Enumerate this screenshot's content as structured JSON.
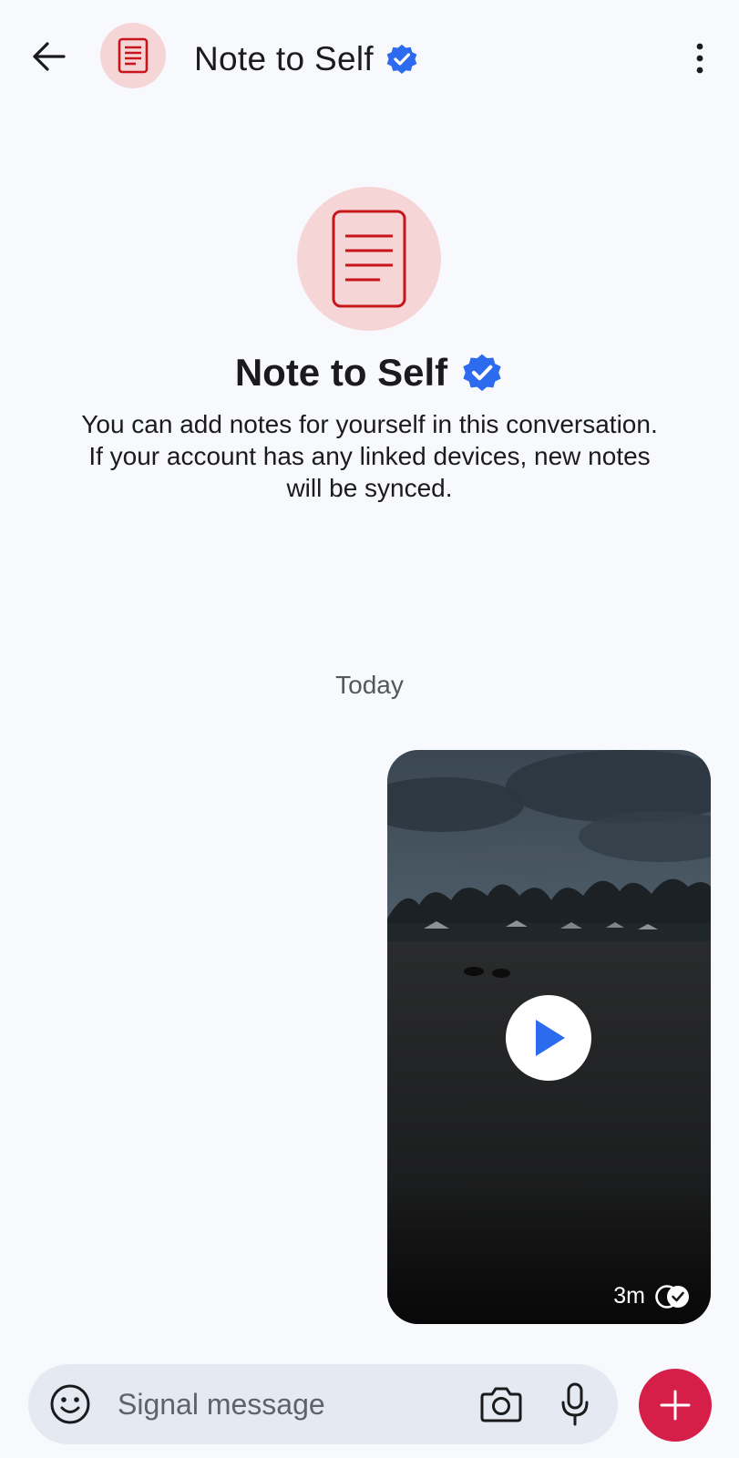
{
  "header": {
    "title": "Note to Self",
    "verified": true
  },
  "profile": {
    "name": "Note to Self",
    "description_line1": "You can add notes for yourself in this conversation.",
    "description_line2": "If your account has any linked devices, new notes will be synced."
  },
  "conversation": {
    "date_divider": "Today",
    "messages": [
      {
        "type": "video",
        "time": "3m",
        "status": "delivered"
      }
    ]
  },
  "composer": {
    "placeholder": "Signal message",
    "value": ""
  },
  "icons": {
    "back": "arrow-left-icon",
    "avatar": "note-document-icon",
    "verified": "verified-badge-icon",
    "more": "more-vertical-icon",
    "play": "play-icon",
    "delivered": "double-check-icon",
    "emoji": "smiley-icon",
    "camera": "camera-icon",
    "mic": "microphone-icon",
    "add": "plus-icon"
  },
  "colors": {
    "background": "#f8f9fd",
    "avatar_bg": "#f5d5d6",
    "avatar_icon": "#c8151c",
    "verified": "#2c6bed",
    "accent_add": "#d51f48",
    "composer_bg": "#e5e9f2",
    "play_icon": "#2c6bed"
  }
}
